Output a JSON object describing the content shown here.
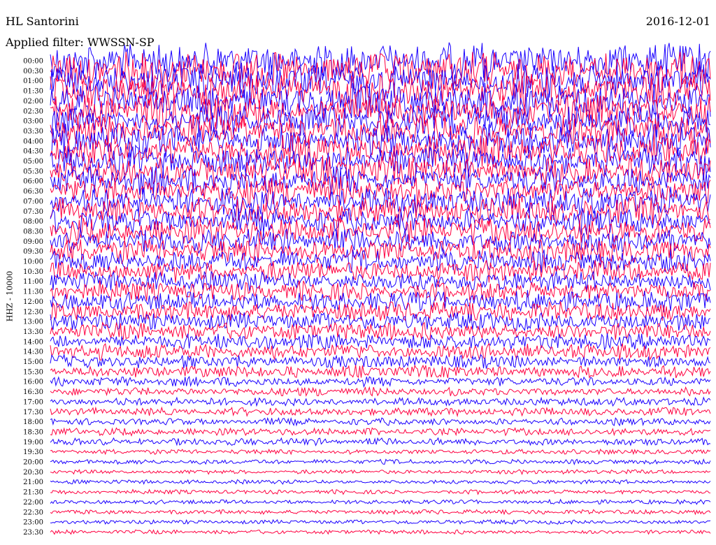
{
  "header": {
    "station": "HL Santorini",
    "date": "2016-12-01",
    "filter_label": "Applied filter:",
    "filter_name": "WWSSN-SP"
  },
  "chart_data": {
    "type": "line",
    "title": "",
    "ylabel": "HHZ - 10000",
    "xlabel": "",
    "grid": false,
    "legend": "none",
    "colors": [
      "#1a00ff",
      "#ff0040"
    ],
    "rows": [
      "00:00",
      "00:30",
      "01:00",
      "01:30",
      "02:00",
      "02:30",
      "03:00",
      "03:30",
      "04:00",
      "04:30",
      "05:00",
      "05:30",
      "06:00",
      "06:30",
      "07:00",
      "07:30",
      "08:00",
      "08:30",
      "09:00",
      "09:30",
      "10:00",
      "10:30",
      "11:00",
      "11:30",
      "12:00",
      "12:30",
      "13:00",
      "13:30",
      "14:00",
      "14:30",
      "15:00",
      "15:30",
      "16:00",
      "16:30",
      "17:00",
      "17:30",
      "18:00",
      "18:30",
      "19:00",
      "19:30",
      "20:00",
      "20:30",
      "21:00",
      "21:30",
      "22:00",
      "22:30",
      "23:00",
      "23:30"
    ],
    "amplitude_relative": [
      2.3,
      2.3,
      2.2,
      2.2,
      2.1,
      2.1,
      2.0,
      2.0,
      2.0,
      2.0,
      1.9,
      1.9,
      1.8,
      1.8,
      1.7,
      1.7,
      1.6,
      1.6,
      1.5,
      1.5,
      1.4,
      1.4,
      1.3,
      1.3,
      1.3,
      1.2,
      1.1,
      1.1,
      1.0,
      1.0,
      0.85,
      0.8,
      0.6,
      0.55,
      0.5,
      0.5,
      0.45,
      0.45,
      0.45,
      0.3,
      0.3,
      0.28,
      0.28,
      0.28,
      0.28,
      0.28,
      0.26,
      0.26
    ]
  }
}
